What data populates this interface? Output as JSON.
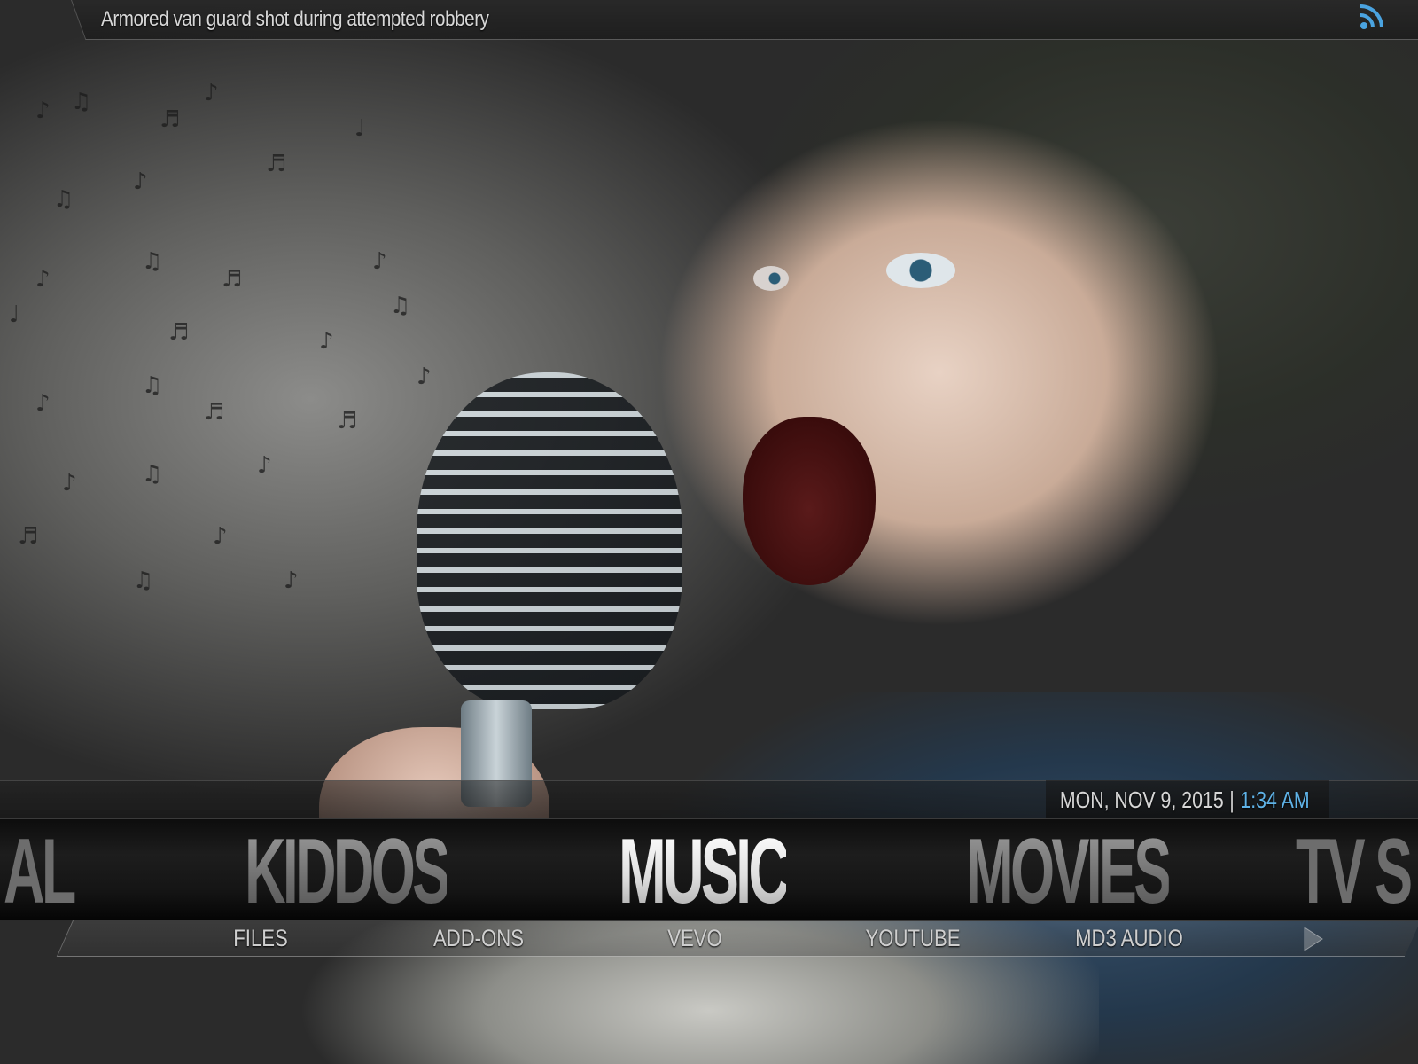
{
  "header": {
    "ticker_text": "Armored van guard shot during attempted robbery",
    "feed_icon": "rss-icon"
  },
  "clock": {
    "date": "MON, NOV 9, 2015",
    "separator": "|",
    "time": "1:34 AM",
    "time_color": "#5fb3e8"
  },
  "main_menu": {
    "items": [
      {
        "label": "AL",
        "state": "partial"
      },
      {
        "label": "KIDDOS",
        "state": "normal"
      },
      {
        "label": "MUSIC",
        "state": "selected"
      },
      {
        "label": "MOVIES",
        "state": "normal"
      },
      {
        "label": "TV S",
        "state": "partial"
      }
    ]
  },
  "sub_menu": {
    "items": [
      {
        "label": "FILES"
      },
      {
        "label": "ADD-ONS"
      },
      {
        "label": "VEVO"
      },
      {
        "label": "YOUTUBE"
      },
      {
        "label": "MD3 AUDIO"
      }
    ],
    "next_icon": "chevron-right-icon"
  },
  "background": {
    "description_icon": "fanart-image"
  }
}
